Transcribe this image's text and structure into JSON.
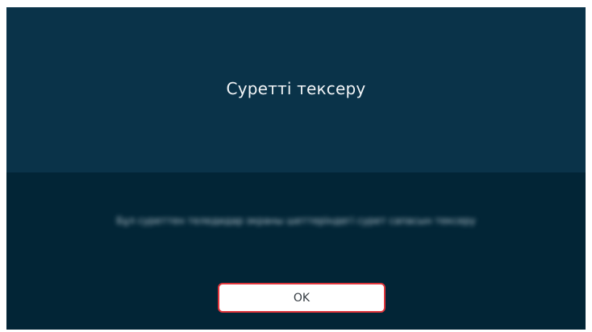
{
  "dialog": {
    "title": "Суретті тексеру",
    "message": "Бұл суреттен теледидар экраны шеттеріндегі сурет сапасын тексеру",
    "ok_label": "OK"
  },
  "colors": {
    "header_bg": "#0a3349",
    "body_bg": "#022536",
    "button_border": "#e0353b",
    "button_bg": "#ffffff"
  }
}
